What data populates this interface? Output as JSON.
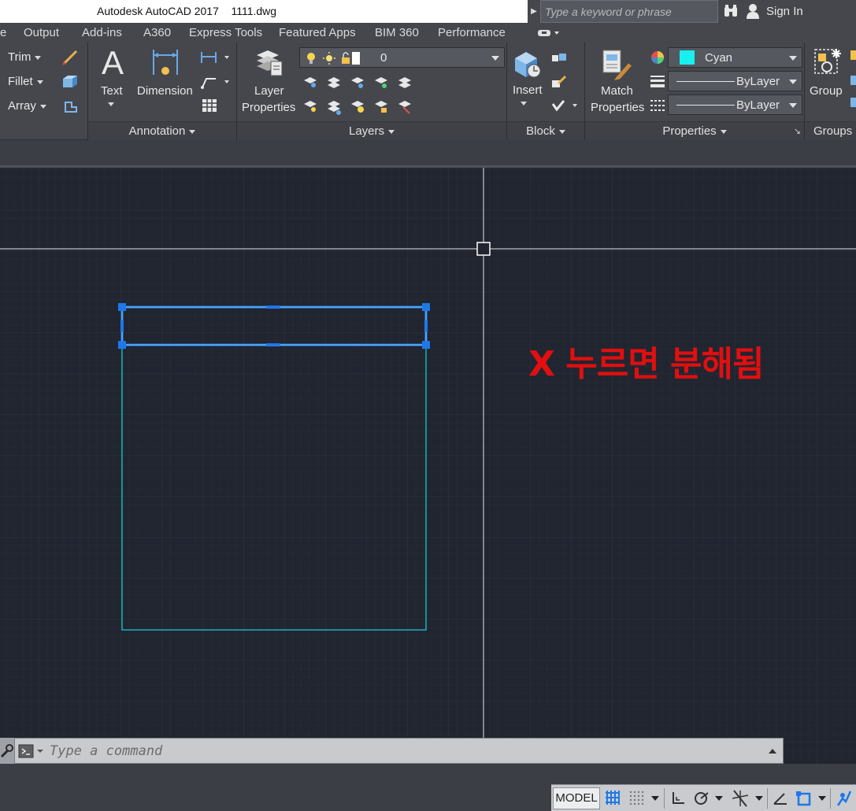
{
  "titlebar": {
    "app_title": "Autodesk AutoCAD 2017",
    "file_name": "1111.dwg",
    "search_placeholder": "Type a keyword or phrase",
    "sign_in": "Sign In"
  },
  "menu_tabs": [
    "e",
    "Output",
    "Add-ins",
    "A360",
    "Express Tools",
    "Featured Apps",
    "BIM 360",
    "Performance"
  ],
  "ribbon": {
    "modify": {
      "trim": "Trim",
      "fillet": "Fillet",
      "array": "Array"
    },
    "annotation": {
      "text": "Text",
      "dimension": "Dimension",
      "panel_title": "Annotation"
    },
    "layers": {
      "layer_properties_line1": "Layer",
      "layer_properties_line2": "Properties",
      "current_layer": "0",
      "panel_title": "Layers"
    },
    "block": {
      "insert": "Insert",
      "panel_title": "Block"
    },
    "properties": {
      "match_line1": "Match",
      "match_line2": "Properties",
      "color": "Cyan",
      "color_hex": "#18f0f0",
      "lineweight": "ByLayer",
      "linetype": "ByLayer",
      "panel_title": "Properties"
    },
    "groups": {
      "group": "Group",
      "panel_title": "Groups"
    }
  },
  "drawing": {
    "annotation_text": "X 누르면 분해됨",
    "annotation_color": "#e10f0f",
    "background": "#212530",
    "object_color": "#18d4dc",
    "selection_color": "#1e90ff"
  },
  "command_line": {
    "placeholder": "Type a command"
  },
  "status_bar": {
    "model": "MODEL"
  }
}
